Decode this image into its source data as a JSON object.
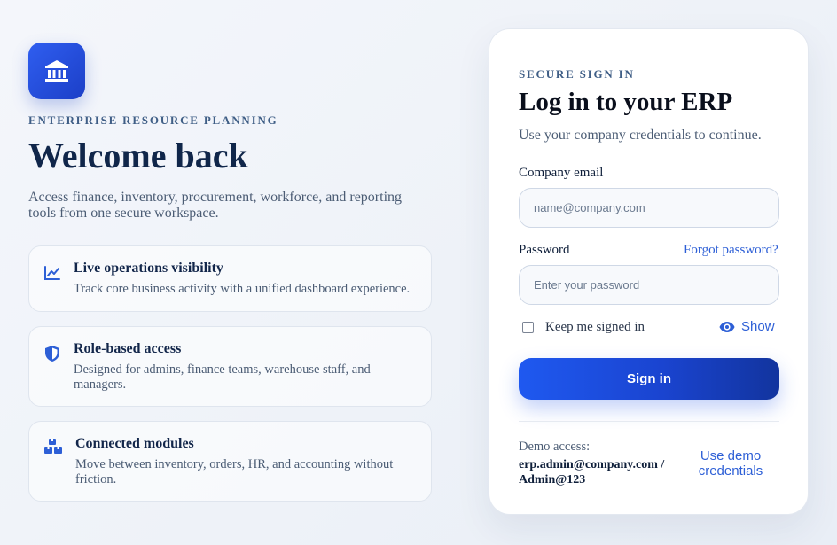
{
  "left": {
    "eyebrow": "ENTERPRISE RESOURCE PLANNING",
    "title": "Welcome back",
    "lead": "Access finance, inventory, procurement, workforce, and reporting tools from one secure workspace.",
    "logo_icon": "bank-building-icon",
    "features": [
      {
        "icon": "line-chart-icon",
        "title": "Live operations visibility",
        "desc": "Track core business activity with a unified dashboard experience."
      },
      {
        "icon": "shield-icon",
        "title": "Role-based access",
        "desc": "Designed for admins, finance teams, warehouse staff, and managers."
      },
      {
        "icon": "boxes-icon",
        "title": "Connected modules",
        "desc": "Move between inventory, orders, HR, and accounting without friction."
      }
    ]
  },
  "card": {
    "eyebrow": "SECURE SIGN IN",
    "title": "Log in to your ERP",
    "subtitle": "Use your company credentials to continue.",
    "email_label": "Company email",
    "email_placeholder": "name@company.com",
    "email_value": "",
    "password_label": "Password",
    "password_placeholder": "Enter your password",
    "password_value": "",
    "forgot": "Forgot password?",
    "keep_signed_in": "Keep me signed in",
    "keep_checked": false,
    "show": "Show",
    "signin": "Sign in",
    "demo_label": "Demo access:",
    "demo_value": "erp.admin@company.com / Admin@123",
    "use_demo": "Use demo credentials"
  },
  "colors": {
    "accent": "#1f59f0",
    "link": "#2d5fd6",
    "heading": "#10264a",
    "muted": "#4b5c74"
  }
}
